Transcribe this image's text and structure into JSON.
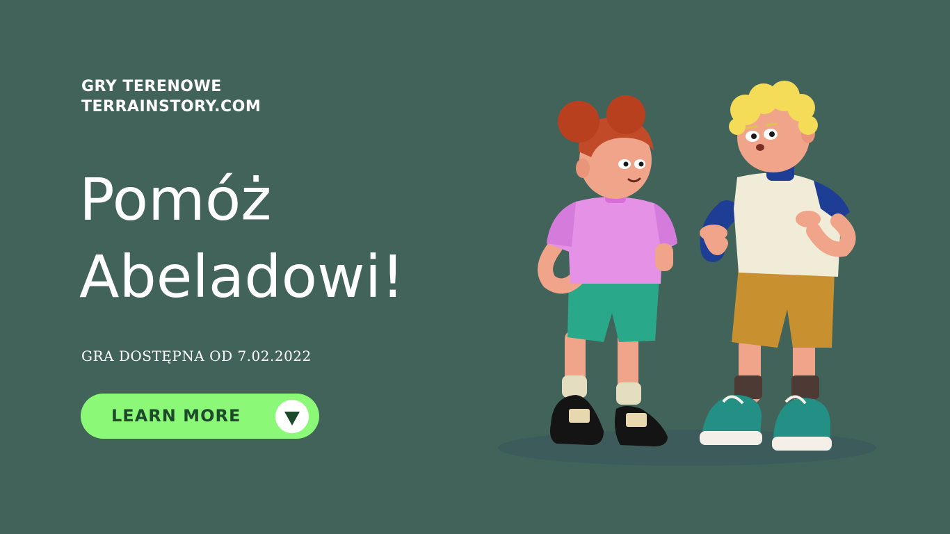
{
  "brand": {
    "line1": "GRY TERENOWE",
    "line2": "TERRAINSTORY.COM"
  },
  "headline": {
    "line1": "Pomóż",
    "line2": "Abeladowi!"
  },
  "availability": "GRA DOSTĘPNA OD 7.02.2022",
  "cta": {
    "label": "LEARN MORE",
    "icon": "triangle-down-icon"
  },
  "illustration": {
    "description_icon": "two-children-illustration"
  },
  "colors": {
    "background": "#42635a",
    "cta_background": "#8cf878",
    "cta_text": "#1e4a2c",
    "text": "#ffffff"
  }
}
